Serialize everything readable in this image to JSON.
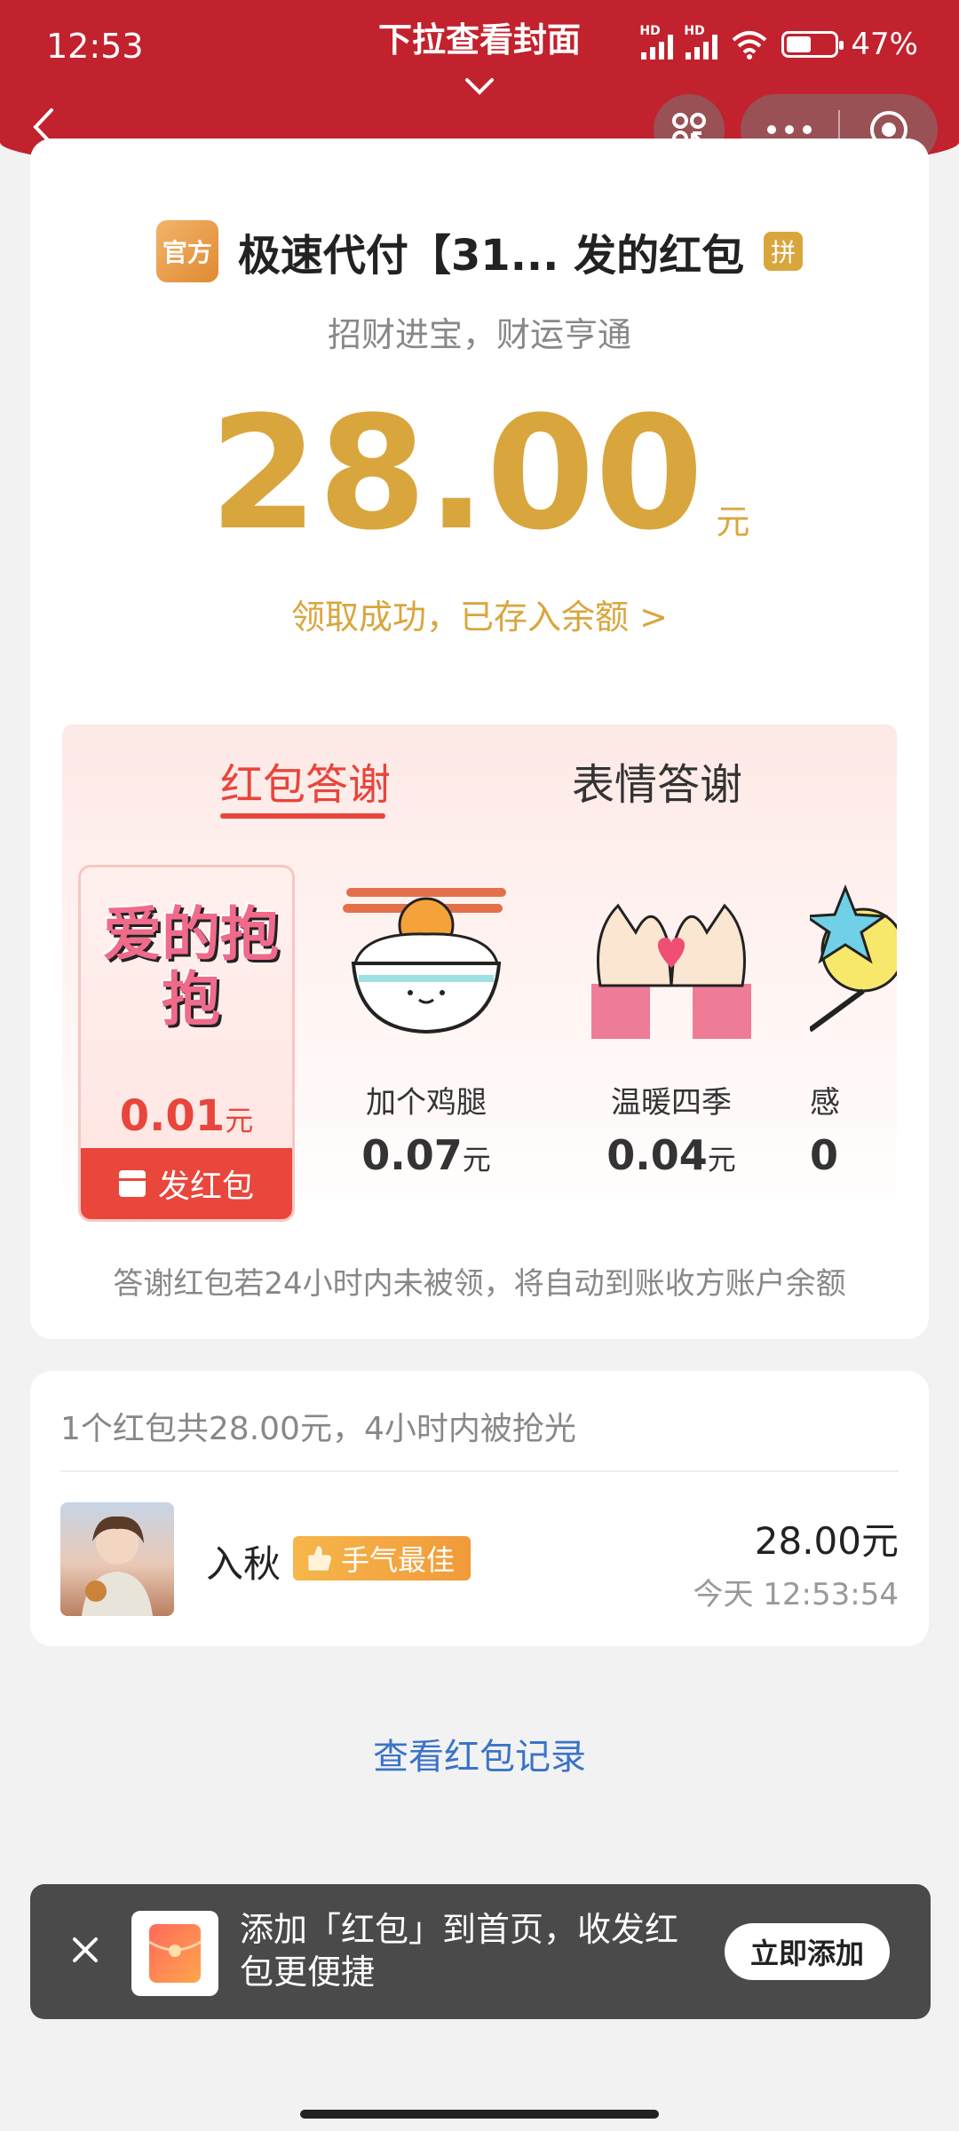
{
  "status_bar": {
    "time": "12:53",
    "battery": "47%",
    "network_label": "HD"
  },
  "pull_hint": "下拉查看封面",
  "sender": {
    "official_badge": "官方",
    "name": "极速代付【31... 发的红包",
    "pin_badge": "拼"
  },
  "greeting": "招财进宝，财运亨通",
  "amount": {
    "value": "28.00",
    "unit": "元"
  },
  "deposit_link": "领取成功，已存入余额 >",
  "thanks": {
    "tabs": [
      "红包答谢",
      "表情答谢"
    ],
    "selected": {
      "art_text": "爱的抱抱",
      "price": "0.01",
      "unit": "元",
      "send_label": "发红包"
    },
    "items": [
      {
        "name": "加个鸡腿",
        "price": "0.07",
        "unit": "元"
      },
      {
        "name": "温暖四季",
        "price": "0.04",
        "unit": "元"
      },
      {
        "name": "感",
        "price": "0",
        "unit": ""
      }
    ],
    "note": "答谢红包若24小时内未被领，将自动到账收方账户余额"
  },
  "records": {
    "summary": "1个红包共28.00元，4小时内被抢光",
    "entry": {
      "name": "入秋",
      "badge": "手气最佳",
      "amount": "28.00元",
      "time": "今天 12:53:54"
    }
  },
  "view_records_link": "查看红包记录",
  "toast": {
    "text": "添加「红包」到首页，收发红包更便捷",
    "button": "立即添加"
  },
  "colors": {
    "header_red": "#c1222e",
    "gold": "#d9a63e",
    "accent_red": "#e8453c",
    "link_blue": "#3a73c9"
  }
}
